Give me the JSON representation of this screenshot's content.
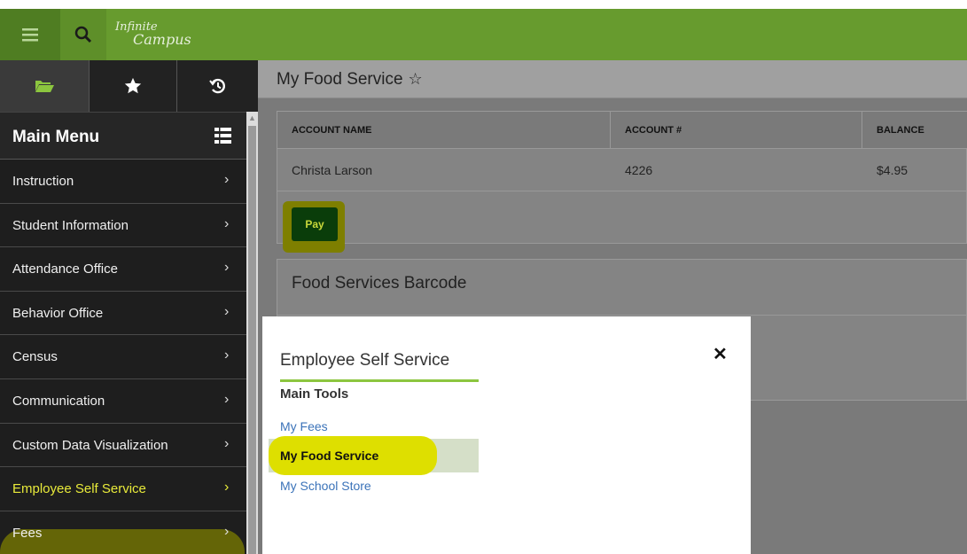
{
  "topbar": {
    "logo_line1": "Infinite",
    "logo_line2": "Campus",
    "icons": [
      "hamburger-menu-icon",
      "search-icon"
    ]
  },
  "sidebar": {
    "tabs": [
      {
        "icon": "folder-open-icon"
      },
      {
        "icon": "star-icon"
      },
      {
        "icon": "history-icon"
      }
    ],
    "header_title": "Main Menu",
    "items": [
      {
        "label": "Instruction"
      },
      {
        "label": "Student Information"
      },
      {
        "label": "Attendance Office"
      },
      {
        "label": "Behavior Office"
      },
      {
        "label": "Census"
      },
      {
        "label": "Communication"
      },
      {
        "label": "Custom Data Visualization"
      },
      {
        "label": "Employee Self Service"
      },
      {
        "label": "Fees"
      }
    ],
    "chevron": "›"
  },
  "page": {
    "title": "My Food Service",
    "star": "☆"
  },
  "account_table": {
    "columns": [
      "ACCOUNT NAME",
      "ACCOUNT #",
      "BALANCE"
    ],
    "rows": [
      [
        "Christa Larson",
        "4226",
        "$4.95"
      ]
    ]
  },
  "pay_button": "Pay",
  "barcode_card": {
    "title": "Food Services Barcode"
  },
  "popup": {
    "title": "Employee Self Service",
    "close": "✕",
    "section": "Main Tools",
    "links": [
      "My Fees",
      "My Food Service",
      "My School Store"
    ]
  },
  "colors": {
    "topbar": "#679b2e",
    "sidebar": "#1e1e1e",
    "highlight": "#dedf00",
    "link": "#3b73b9",
    "pay_button": "#0a3d0a"
  }
}
